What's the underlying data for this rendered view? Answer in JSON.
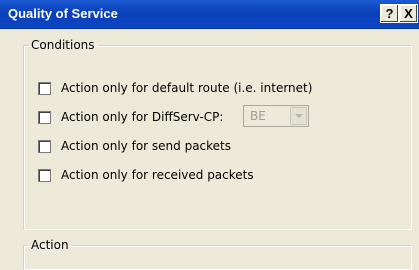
{
  "window": {
    "title": "Quality of Service",
    "help_label": "?",
    "close_label": "X"
  },
  "conditions": {
    "legend": "Conditions",
    "options": [
      {
        "label": "Action only for default route (i.e. internet)",
        "checked": false
      },
      {
        "label": "Action only for DiffServ-CP:",
        "checked": false
      },
      {
        "label": "Action only for send packets",
        "checked": false
      },
      {
        "label": "Action only for received packets",
        "checked": false
      }
    ],
    "diffserv_select": {
      "value": "BE",
      "enabled": false
    }
  },
  "action": {
    "legend": "Action"
  }
}
